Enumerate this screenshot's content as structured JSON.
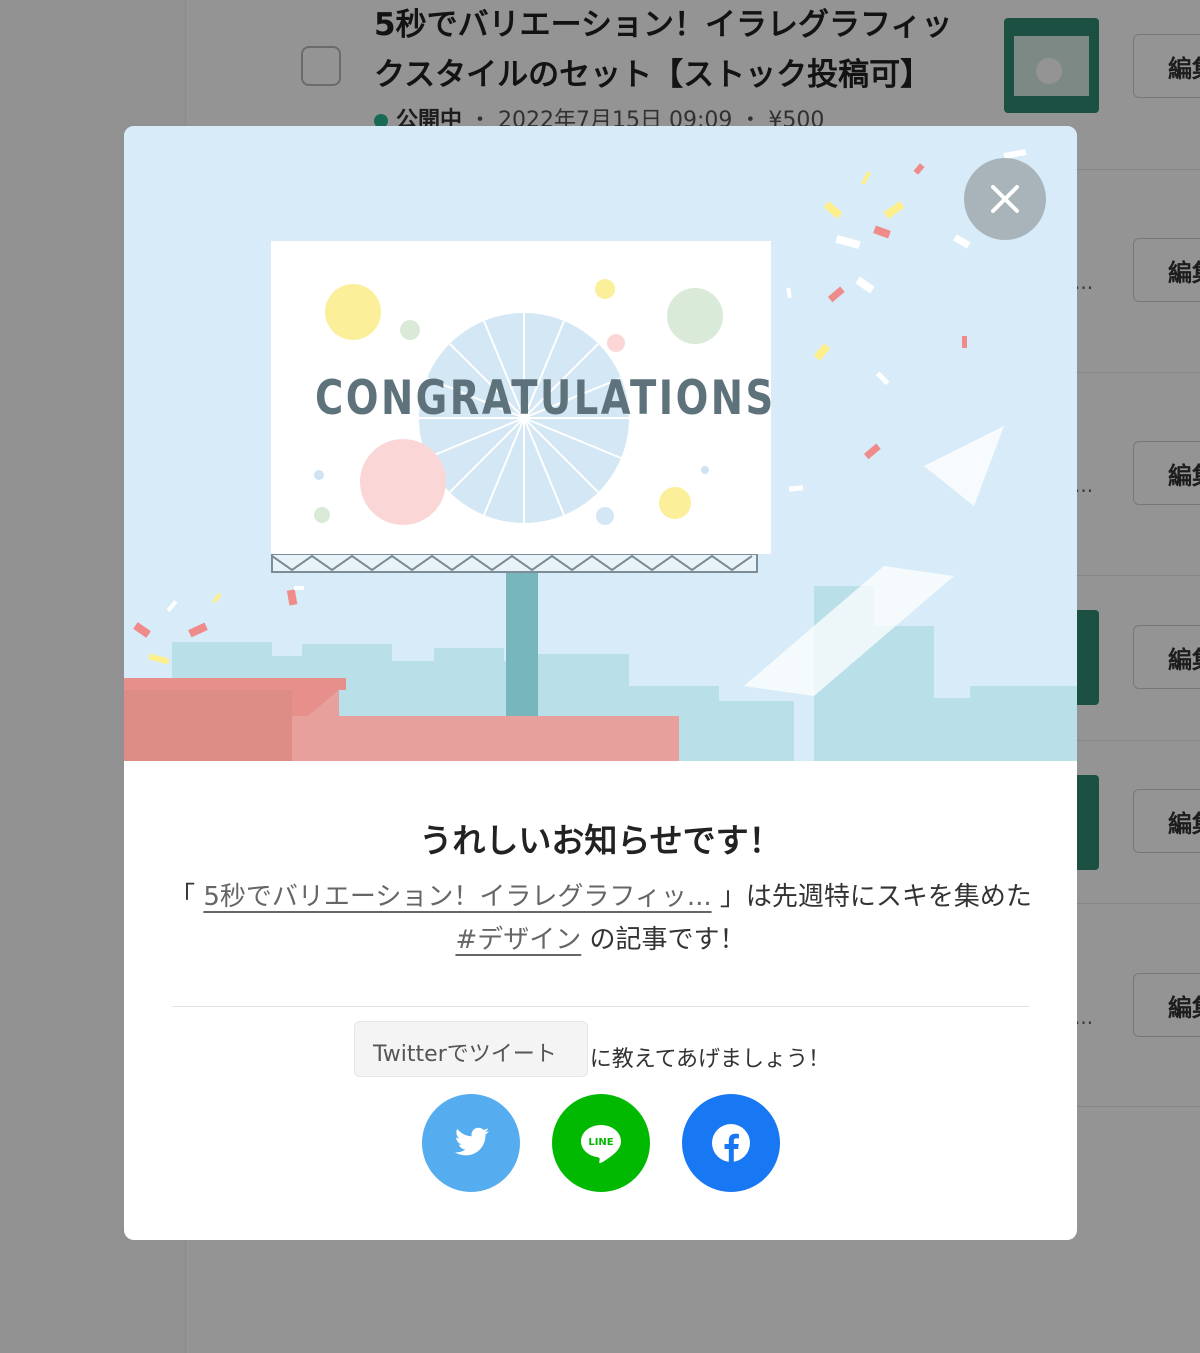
{
  "background": {
    "article": {
      "title": "5秒でバリエーション！イラレグラフィックスタイルのセット【ストック投稿可】",
      "status": "公開中",
      "separator": "・",
      "date": "2022年7月15日 09:09",
      "price": "¥500"
    },
    "edit_label": "編集",
    "ellipsis": "..."
  },
  "modal": {
    "close_icon": "close-icon",
    "hero": {
      "billboard_text": "CONGRATULATIONS"
    },
    "heading": "うれしいお知らせです！",
    "description": {
      "open_bracket": "「",
      "article_link": "5秒でバリエーション！イラレグラフィッ...",
      "middle": "」は先週特にスキを集めた",
      "tag_link": "#デザイン",
      "end": "の記事です！"
    },
    "share_prompt": "スキしてくれたみんなに教えてあげましょう！",
    "tooltip": "Twitterでツイート",
    "share_buttons": [
      {
        "name": "twitter",
        "icon": "twitter-icon",
        "color": "#55acee"
      },
      {
        "name": "line",
        "icon": "line-icon",
        "label": "LINE",
        "color": "#00b900"
      },
      {
        "name": "facebook",
        "icon": "facebook-icon",
        "color": "#1877f2"
      }
    ]
  }
}
